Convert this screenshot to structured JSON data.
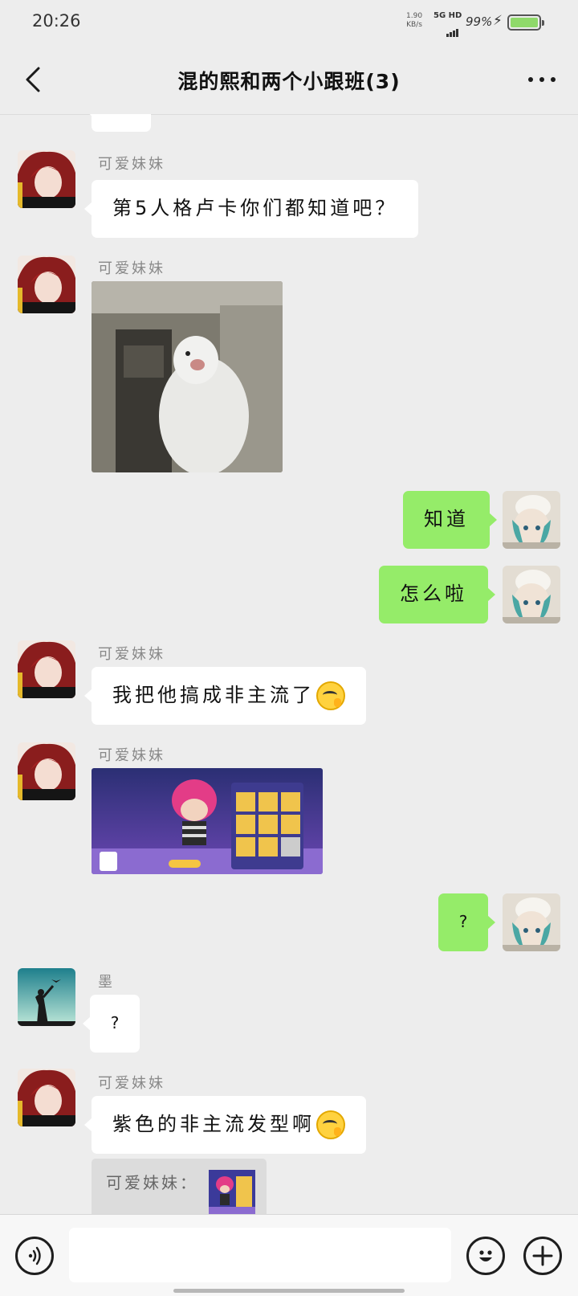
{
  "status_bar": {
    "time": "20:26",
    "speed_value": "1.90",
    "speed_unit": "KB/s",
    "network": "5G HD",
    "battery_percent": "99%"
  },
  "header": {
    "title": "混的熙和两个小跟班(3)"
  },
  "messages": [
    {
      "type": "text",
      "side": "left",
      "sender": "可爱妹妹",
      "text": "第5人格卢卡你们都知道吧？"
    },
    {
      "type": "image",
      "side": "left",
      "sender": "可爱妹妹",
      "image": "white-bird-gif"
    },
    {
      "type": "text",
      "side": "right",
      "text": "知道"
    },
    {
      "type": "text",
      "side": "right",
      "text": "怎么啦"
    },
    {
      "type": "text",
      "side": "left",
      "sender": "可爱妹妹",
      "text": "我把他搞成非主流了",
      "emoji": "smirk-emoji"
    },
    {
      "type": "image",
      "side": "left",
      "sender": "可爱妹妹",
      "image": "game-avatar-screenshot"
    },
    {
      "type": "text",
      "side": "right",
      "text": "?"
    },
    {
      "type": "text",
      "side": "left",
      "sender": "墨",
      "text": "?"
    },
    {
      "type": "text",
      "side": "left",
      "sender": "可爱妹妹",
      "text": "紫色的非主流发型啊",
      "emoji": "smirk-emoji"
    },
    {
      "type": "quote",
      "side": "left",
      "quote_label": "可爱妹妹：",
      "image": "game-avatar-thumbnail"
    }
  ],
  "input": {
    "voice_icon": "voice-icon",
    "emoji_icon": "emoji-icon",
    "plus_icon": "plus-icon",
    "placeholder": ""
  },
  "colors": {
    "background": "#ededed",
    "outgoing_bubble": "#95ec69",
    "incoming_bubble": "#ffffff"
  }
}
